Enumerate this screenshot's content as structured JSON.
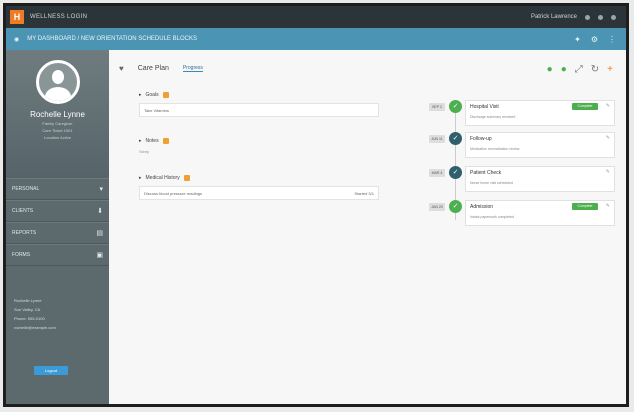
{
  "topbar": {
    "app_name": "WELLNESS LOGIN",
    "user": "Patrick Lawrence",
    "icons": [
      "bell-icon",
      "user-icon",
      "settings-icon"
    ]
  },
  "subbar": {
    "breadcrumb": "MY DASHBOARD / NEW ORIENTATION SCHEDULE BLOCKS",
    "icons": [
      "globe-icon",
      "star-icon",
      "gear-icon"
    ]
  },
  "profile": {
    "name": "Rochelle Lynne",
    "lines": [
      "Family Caregiver",
      "Care Ticket 1001",
      "Location Active"
    ]
  },
  "nav": [
    {
      "label": "PERSONAL",
      "icon": "▾"
    },
    {
      "label": "CLIENTS",
      "icon": "⬇"
    },
    {
      "label": "REPORTS",
      "icon": "▤"
    },
    {
      "label": "FORMS",
      "icon": "▣"
    }
  ],
  "contact": {
    "lines": [
      "Rochelle Lynne",
      "Sun Valley, CA",
      "Phone: 555-0100",
      "rochelle@example.com"
    ]
  },
  "sidebar_button": "Logout",
  "main": {
    "tabs": [
      "Care Plan",
      "Progress"
    ],
    "sections": [
      {
        "title": "Goals",
        "row": "Take Vitamins",
        "right": ""
      },
      {
        "title": "Notes",
        "row": "",
        "sub": "Sleep"
      },
      {
        "title": "Medical History",
        "row": "Discuss blood pressure readings",
        "right": "Started 3/1"
      }
    ],
    "timeline": [
      {
        "date": "SEP 2",
        "title": "Hospital Visit",
        "sub": "Discharge summary received",
        "color": "#4caf50",
        "icon": "✓",
        "action": "Complete"
      },
      {
        "date": "JUN 11",
        "title": "Follow-up",
        "sub": "Medication reconciliation review",
        "color": "#2f5f6d",
        "icon": "✓",
        "action": ""
      },
      {
        "date": "MAR 4",
        "title": "Patient Check",
        "sub": "Nurse home visit scheduled",
        "color": "#2f5f6d",
        "icon": "✓",
        "action": ""
      },
      {
        "date": "JAN 20",
        "title": "Admission",
        "sub": "Intake paperwork completed",
        "color": "#4caf50",
        "icon": "✓",
        "action": "Complete"
      }
    ]
  },
  "colors": {
    "topbar": "#2b3438",
    "accent": "#4c94b3",
    "sidebar": "#5c6a6d",
    "logo": "#f07b22"
  }
}
